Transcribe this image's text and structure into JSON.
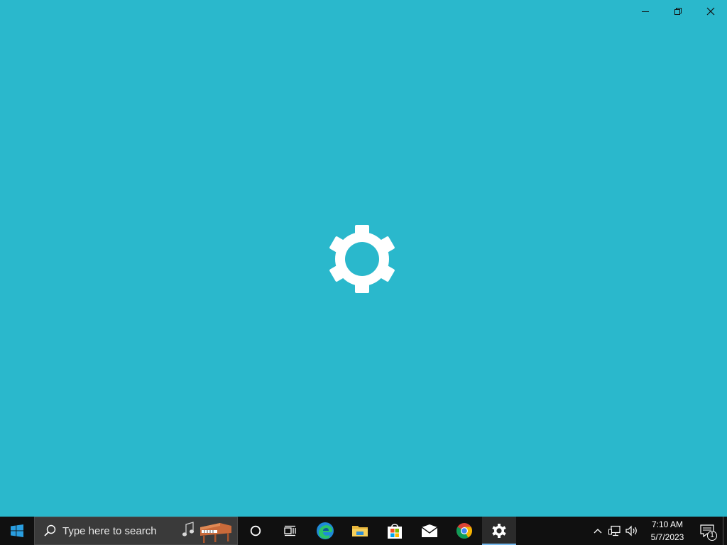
{
  "window": {
    "controls": [
      {
        "name": "minimize",
        "icon": "minimize-icon"
      },
      {
        "name": "restore",
        "icon": "restore-icon"
      },
      {
        "name": "close",
        "icon": "close-icon"
      }
    ],
    "splash_icon": "settings-gear-icon",
    "background_color": "#2ab8cc"
  },
  "taskbar": {
    "search": {
      "placeholder": "Type here to search",
      "highlight_icon": "music-piano-highlight-icon"
    },
    "apps": [
      {
        "name": "cortana",
        "icon": "cortana-circle-icon"
      },
      {
        "name": "task-view",
        "icon": "task-view-icon"
      },
      {
        "name": "edge",
        "icon": "edge-icon"
      },
      {
        "name": "file-explorer",
        "icon": "folder-icon"
      },
      {
        "name": "microsoft-store",
        "icon": "store-icon"
      },
      {
        "name": "mail",
        "icon": "mail-icon"
      },
      {
        "name": "chrome",
        "icon": "chrome-icon"
      },
      {
        "name": "settings",
        "icon": "gear-icon",
        "active": true
      }
    ],
    "tray": {
      "icons": [
        "chevron-up-icon",
        "network-icon",
        "volume-icon"
      ],
      "time": "7:10 AM",
      "date": "5/7/2023",
      "notification_count": "1"
    }
  }
}
